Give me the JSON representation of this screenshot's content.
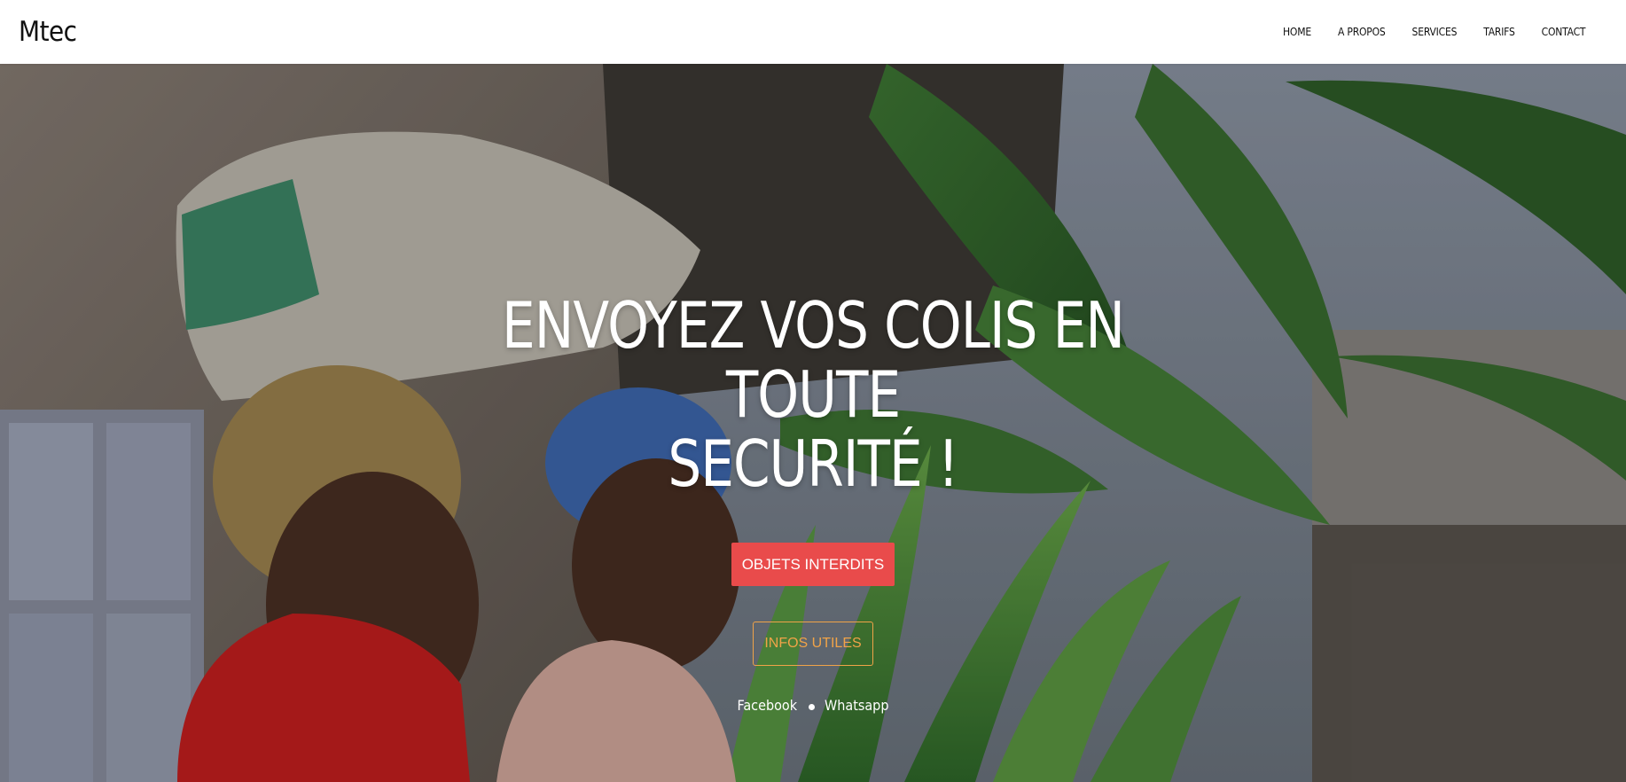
{
  "navbar": {
    "brand": "Mtec",
    "links": [
      "HOME",
      "A PROPOS",
      "SERVICES",
      "TARIFS",
      "CONTACT"
    ]
  },
  "hero": {
    "title_line1": "ENVOYEZ VOS COLIS EN TOUTE",
    "title_line2": "SECURITÉ !",
    "primary_button": "OBJETS INTERDITS",
    "secondary_button": "INFOS UTILES",
    "social": [
      "Facebook",
      "Whatsapp"
    ]
  },
  "colors": {
    "primary_button_bg": "#e94b4b",
    "secondary_button_accent": "#f0a348"
  }
}
